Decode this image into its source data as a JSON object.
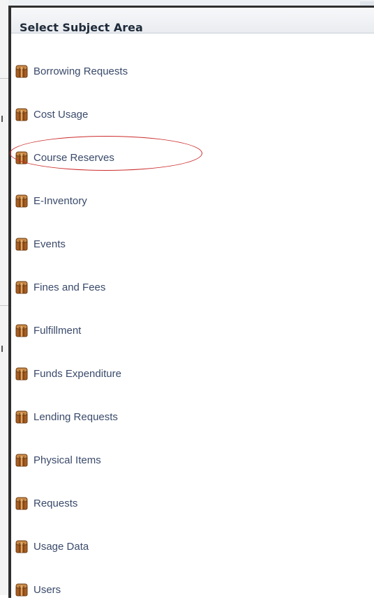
{
  "dialog": {
    "title": "Select Subject Area"
  },
  "subject_areas": [
    {
      "label": "Borrowing Requests",
      "icon": "subject-cube-icon"
    },
    {
      "label": "Cost Usage",
      "icon": "subject-cube-icon"
    },
    {
      "label": "Course Reserves",
      "icon": "subject-cube-icon",
      "highlighted": true
    },
    {
      "label": "E-Inventory",
      "icon": "subject-cube-icon"
    },
    {
      "label": "Events",
      "icon": "subject-cube-icon"
    },
    {
      "label": "Fines and Fees",
      "icon": "subject-cube-icon"
    },
    {
      "label": "Fulfillment",
      "icon": "subject-cube-icon"
    },
    {
      "label": "Funds Expenditure",
      "icon": "subject-cube-icon"
    },
    {
      "label": "Lending Requests",
      "icon": "subject-cube-icon"
    },
    {
      "label": "Physical Items",
      "icon": "subject-cube-icon"
    },
    {
      "label": "Requests",
      "icon": "subject-cube-icon"
    },
    {
      "label": "Usage Data",
      "icon": "subject-cube-icon"
    },
    {
      "label": "Users",
      "icon": "subject-cube-icon"
    }
  ],
  "colors": {
    "title_text": "#1f2b3a",
    "item_text": "#3a4a6a",
    "highlight": "#cc2b2b",
    "icon_brown": "#b8702e"
  }
}
